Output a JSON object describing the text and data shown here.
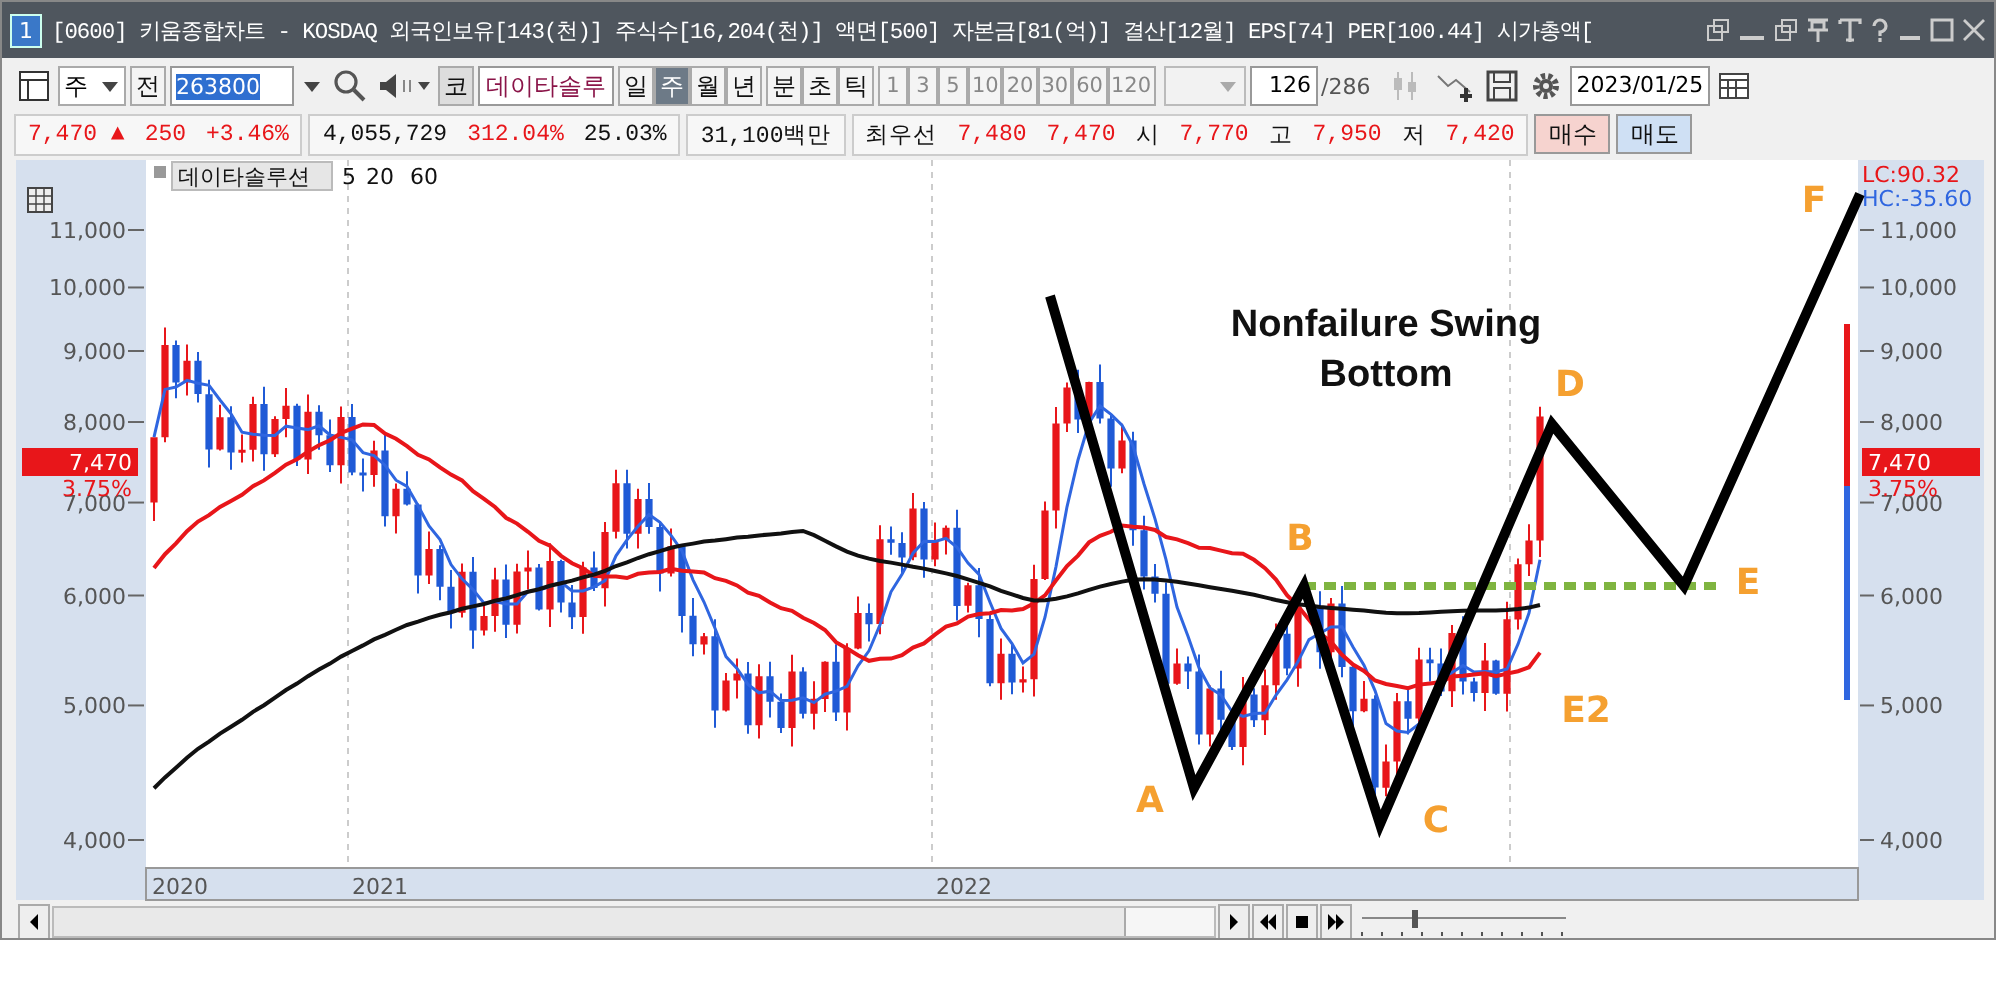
{
  "window": {
    "number": "1",
    "title": "[0600] 키움종합차트 - KOSDAQ 외국인보유[143(천)] 주식수[16,204(천)] 액면[500] 자본금[81(억)] 결산[12월] EPS[74] PER[100.44] 시가총액["
  },
  "toolbar": {
    "period_select": "주",
    "all_button": "전",
    "code": "263800",
    "market_button": "코",
    "stock_name": "데이타솔루",
    "periods": [
      {
        "label": "일",
        "selected": false
      },
      {
        "label": "주",
        "selected": true
      },
      {
        "label": "월",
        "selected": false
      },
      {
        "label": "년",
        "selected": false
      }
    ],
    "intraday": [
      "분",
      "초",
      "틱"
    ],
    "intervals": [
      "1",
      "3",
      "5",
      "10",
      "20",
      "30",
      "60",
      "120"
    ],
    "count": "126",
    "total": "/286",
    "date": "2023/01/25"
  },
  "quote": {
    "groups": [
      [
        {
          "text": "7,470 ▲",
          "kind": "up"
        },
        {
          "text": "250",
          "kind": "up"
        },
        {
          "text": "+3.46%",
          "kind": "up"
        }
      ],
      [
        {
          "text": "4,055,729",
          "kind": "plain"
        },
        {
          "text": "312.04%",
          "kind": "up"
        },
        {
          "text": "25.03%",
          "kind": "plain"
        }
      ],
      [
        {
          "text": "31,100백만",
          "kind": "plain"
        }
      ],
      [
        {
          "text": "최우선",
          "kind": "plain"
        },
        {
          "text": "7,480",
          "kind": "up"
        },
        {
          "text": "7,470",
          "kind": "up"
        },
        {
          "text": "시",
          "kind": "plain"
        },
        {
          "text": "7,770",
          "kind": "up"
        },
        {
          "text": "고",
          "kind": "plain"
        },
        {
          "text": "7,950",
          "kind": "up"
        },
        {
          "text": "저",
          "kind": "plain"
        },
        {
          "text": "7,420",
          "kind": "up"
        }
      ]
    ],
    "buttons": [
      {
        "label": "매수",
        "kind": "buy"
      },
      {
        "label": "매도",
        "kind": "sell"
      }
    ]
  },
  "chart": {
    "legend": {
      "name": "데이타솔루션",
      "averages": [
        {
          "label": "5",
          "kind": "short"
        },
        {
          "label": "20",
          "kind": "mid"
        },
        {
          "label": "60",
          "kind": "long"
        }
      ]
    },
    "left_ticks": [
      "11,000",
      "10,000",
      "9,000",
      "8,000",
      "7,000",
      "6,000",
      "5,000",
      "4,000"
    ],
    "right_ticks": [
      "11,000",
      "10,000",
      "9,000",
      "8,000",
      "7,000",
      "6,000",
      "5,000",
      "4,000"
    ],
    "left_tag": {
      "price": "7,470",
      "change": "3.75%"
    },
    "right_tag": {
      "price": "7,470",
      "change": "3.75%"
    },
    "lc": "LC:90.32",
    "hc": "HC:-35.60",
    "x_labels": [
      "2020",
      "2021",
      "2022"
    ],
    "annotation": {
      "title": "Nonfailure Swing Bottom",
      "points": [
        {
          "label": "A"
        },
        {
          "label": "B"
        },
        {
          "label": "C"
        },
        {
          "label": "D"
        },
        {
          "label": "E"
        },
        {
          "label": "E2"
        },
        {
          "label": "F"
        }
      ]
    }
  },
  "zoom": {
    "level": 0.25
  }
}
